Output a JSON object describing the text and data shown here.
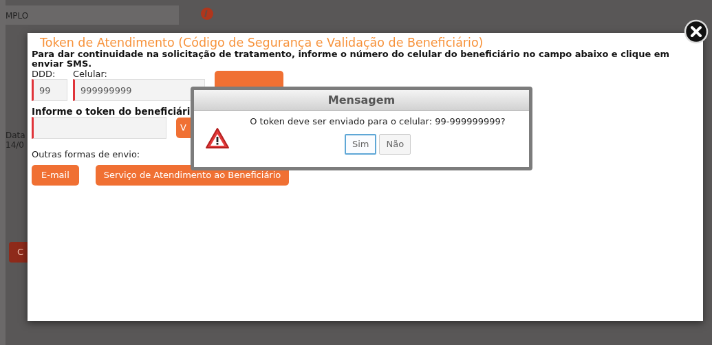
{
  "background": {
    "field_value": "MPLO",
    "date_label": "Data",
    "date_value": "14/0",
    "button_label": "C"
  },
  "modal": {
    "title": "Token de Atendimento (Código de Segurança e Validação de Beneficiário)",
    "instruction": "Para dar continuidade na solicitação de tratamento, informe o número do celular do beneficiário no campo abaixo e clique em enviar SMS.",
    "ddd": {
      "label": "DDD:",
      "value": "99",
      "required": true
    },
    "celular": {
      "label": "Celular:",
      "value": "999999999",
      "required": true
    },
    "token": {
      "label": "Informe o token do beneficiári",
      "required": true
    },
    "validate_button": "V",
    "other_label": "Outras formas de envio:",
    "other_buttons": [
      "E-mail",
      "Serviço de Atendimento ao Beneficiário"
    ]
  },
  "dialog": {
    "title": "Mensagem",
    "message": "O token deve ser enviado para o celular: 99-999999999?",
    "buttons": [
      {
        "label": "Sim",
        "selected": true
      },
      {
        "label": "Não",
        "selected": false
      }
    ]
  }
}
